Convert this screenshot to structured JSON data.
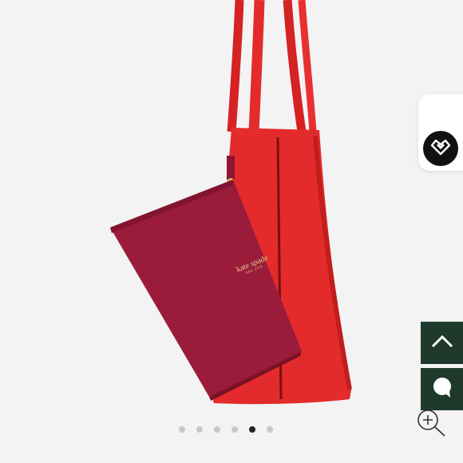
{
  "product_image": {
    "brand_stamp_line1": "kate spade",
    "brand_stamp_line2": "new york",
    "tote_color": "#e32b2b",
    "pouch_color": "#9b1c3a",
    "background": "#f3f3f3"
  },
  "side_actions": {
    "favorite_icon": "heart-diamond-icon",
    "scroll_top_icon": "chevron-up-icon",
    "chat_icon": "chat-bubble-icon",
    "zoom_icon": "zoom-in-icon",
    "accent": "#1f3a2c"
  },
  "carousel": {
    "total": 6,
    "active_index": 4
  }
}
